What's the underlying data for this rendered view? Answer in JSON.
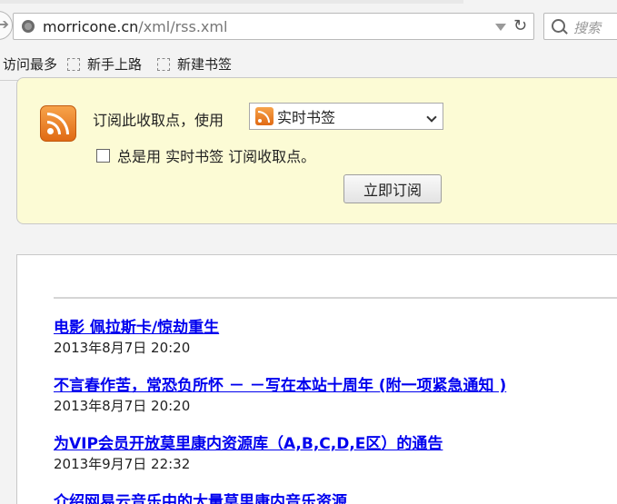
{
  "browser": {
    "url_host": "morricone.cn",
    "url_path": "/xml/rss.xml",
    "search_placeholder": "搜索"
  },
  "bookmarks": [
    {
      "label": "访问最多"
    },
    {
      "label": "新手上路"
    },
    {
      "label": "新建书签"
    }
  ],
  "feed_box": {
    "subscribe_label": "订阅此收取点，使用",
    "reader_selected": "实时书签",
    "always_use_label": "总是用 实时书签 订阅收取点。",
    "subscribe_button": "立即订阅"
  },
  "entries": [
    {
      "title": "电影 佩拉斯卡/惊劫重生",
      "date": "2013年8月7日 20:20"
    },
    {
      "title": "不言春作苦，常恐负所怀 － －写在本站十周年 (附一项紧急通知 )",
      "date": "2013年8月7日 20:20"
    },
    {
      "title": "为VIP会员开放莫里康内资源库（A,B,C,D,E区）的通告",
      "date": "2013年9月7日 22:32"
    },
    {
      "title": "介绍网易云音乐中的大量莫里康内音乐资源",
      "date": ""
    }
  ]
}
